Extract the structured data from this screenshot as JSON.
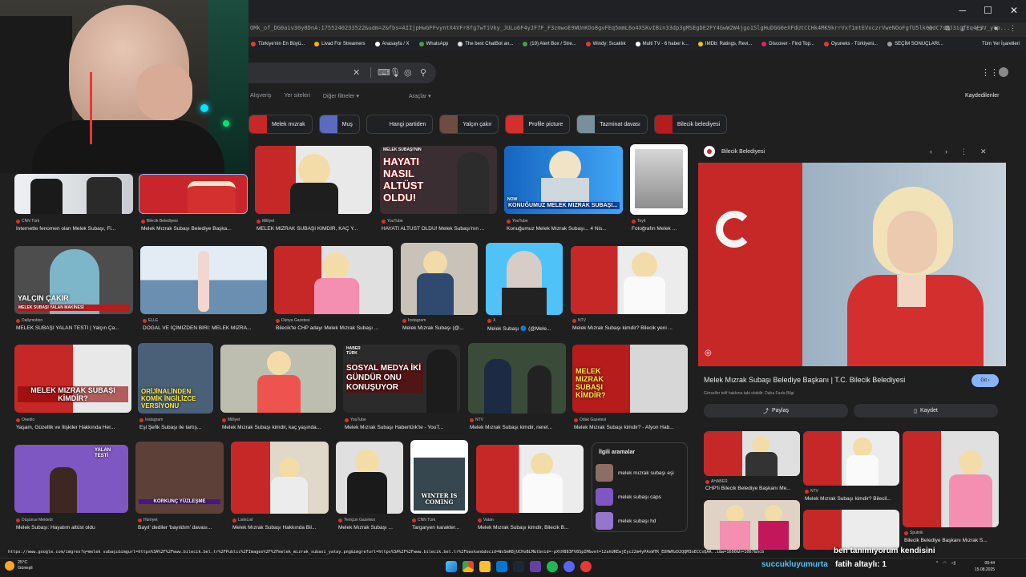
{
  "browser": {
    "address_url": "OMk_of_DG0aiv30y8DnA:1755240233522&udm=2&fbs=AIIjpHwGFFvyntX4VFr8fg7wTiVky_JULu6F4yJF7F_F3zmwoE9WUnKOo8gvFEq5mmL6o4XSKvIBin33dp3gMSEgDE2FY4GwW2W4jgo1SlgHuDGG0eXFdUtCCHk4MK9krrVxf1mtEVxczrVweNOoFgfU5lk00dC7sXJ3igfEq4F3V_yYp...",
    "bookmarks": [
      {
        "label": "Türkiye'nin En Büyü...",
        "color": "#e53935"
      },
      {
        "label": "Livad For Streamers",
        "color": "#ffb300"
      },
      {
        "label": "Anasayfa / X",
        "color": "#ffffff"
      },
      {
        "label": "WhatsApp",
        "color": "#43a047"
      },
      {
        "label": "The best ChatBot an...",
        "color": "#e0e0e0"
      },
      {
        "label": "(19) Alert Box / Stre...",
        "color": "#43a047"
      },
      {
        "label": "Windy: Sıcaklık",
        "color": "#e53935"
      },
      {
        "label": "Multi TV - 6 haber k...",
        "color": "#ffffff"
      },
      {
        "label": "IMDb: Ratings, Revi...",
        "color": "#f5c518"
      },
      {
        "label": "Discover - Find Top...",
        "color": "#e91e63"
      },
      {
        "label": "Oyuneks - Türkiyeni...",
        "color": "#e53935"
      },
      {
        "label": "SEÇİM SONUÇLARI...",
        "color": "#9e9e9e"
      }
    ],
    "all_bookmarks": "Tüm Yer İşaretleri"
  },
  "filters": {
    "tabs": [
      "Alışveriş",
      "Yer siteleri",
      "Diğer filtreler ▾"
    ],
    "tools": "Araçlar ▾",
    "saved": "Kaydedilenler"
  },
  "chips": [
    {
      "label": "Melek mızrak",
      "color": "#c62828"
    },
    {
      "label": "Muş",
      "color": "#5c6bc0"
    },
    {
      "label": "Hangi partiden",
      "color": "#202124"
    },
    {
      "label": "Yalçın çakır",
      "color": "#6d4c41"
    },
    {
      "label": "Profile picture",
      "color": "#d32f2f"
    },
    {
      "label": "Tazminat davası",
      "color": "#78909c"
    },
    {
      "label": "Bilecik belediyesi",
      "color": "#b71c1c"
    }
  ],
  "thumbs": {
    "t1": {
      "src": "CNN Türk",
      "cap": "İnternette fenomen olan Melek Subaşı, Fi..."
    },
    "t2": {
      "src": "Bilecik Belediyesi",
      "cap": "Melek Mızrak Subaşı Belediye Başka..."
    },
    "t3": {
      "src": "Milliyet",
      "cap": "MELEK MIZRAK SUBAŞI KİMDİR, KAÇ Y..."
    },
    "t4": {
      "src": "YouTube",
      "cap": "HAYATI ALTÜST OLDU! Melek Subaşı'nın ...",
      "overlay_top": "MELEK SUBAŞI'NIN",
      "overlay": "HAYATI NASIL ALTÜST OLDU!"
    },
    "t5": {
      "src": "YouTube",
      "cap": "Konuğumuz Melek Mızrak Subaşı... 4 Nis...",
      "overlay_top": "NOW",
      "overlay": "KONUĞUMUZ MELEK MIZRAK SUBAŞI..."
    },
    "t6": {
      "src": "Teyit",
      "cap": "Fotoğrafın Melek ..."
    },
    "t7": {
      "src": "Dailymotion",
      "cap": "MELEK SUBAŞI YALAN TESTİ | Yalçın Ça...",
      "overlay": "YALÇIN ÇAKIR",
      "overlay_sub": "MELEK SUBAŞI YALAN MAKİNESİ"
    },
    "t8": {
      "src": "ELLE",
      "cap": "DOĞAL VE İÇİMİZDEN BİRİ: MELEK MIZRA..."
    },
    "t9": {
      "src": "Dünya Gazetesi",
      "cap": "Bilecik'te CHP adayı Melek Mızrak Subaşı ..."
    },
    "t10": {
      "src": "Instagram",
      "cap": "Melek Mızrak Subaşı (@..."
    },
    "t11": {
      "src": "X",
      "cap": "Melek Subaşı 🔵 (@Mele..."
    },
    "t12": {
      "src": "NTV",
      "cap": "Melek Mızrak Subaşı kimdir? Bilecik yeni ..."
    },
    "t13": {
      "src": "Onedio",
      "cap": "Yaşam, Güzellik ve İlişkiler Hakkında Her...",
      "overlay": "MELEK MIZRAK SUBAŞI KİMDİR?"
    },
    "t14": {
      "src": "Instagram",
      "cap": "Eşi Şefik Subaşı ile tartış...",
      "overlay": "ORİJİNALİNDEN KOMİK İNGİLİZCE VERSİYONU"
    },
    "t15": {
      "src": "Milliyet",
      "cap": "Melek Mızrak Subaşı kimdir, kaç yaşında..."
    },
    "t16": {
      "src": "YouTube",
      "cap": "Melek Mızrak Subaşı Habertürk'te - YouT...",
      "overlay": "SOSYAL MEDYA İKİ GÜNDÜR ONU KONUŞUYOR",
      "overlay_top": "HABER TÜRK"
    },
    "t17": {
      "src": "NTV",
      "cap": "Melek Mızrak Subaşı kimdir, nerel..."
    },
    "t18": {
      "src": "Odak Gazetesi",
      "cap": "Melek Mızrak Subaşı kimdir? - Afyon Hab...",
      "overlay": "MELEK MIZRAK SUBAŞI KİMDİR?"
    },
    "t19": {
      "src": "Düşünce Mektebi",
      "cap": "Melek Subaşı: Hayatım altüst oldu",
      "overlay": "YALAN TESTİ"
    },
    "t20": {
      "src": "Hürriyet",
      "cap": "Bayıl' dediler 'bayıldım' davası...",
      "overlay": "KORKUNÇ YÜZLEŞME"
    },
    "t21": {
      "src": "ListeList",
      "cap": "Melek Mızrak Subaşı Hakkında Bil..."
    },
    "t22": {
      "src": "Yeniçün Gazetesi",
      "cap": "Melek Mızrak Subaşı ..."
    },
    "t23": {
      "src": "CNN Türk",
      "cap": "Targaryen karakter...",
      "overlay": "WINTER IS COMING"
    },
    "t24": {
      "src": "Vatan",
      "cap": "Melek Mızrak Subaşı kimdir, Bilecik B..."
    }
  },
  "related": {
    "title": "İlgili aramalar",
    "items": [
      "melek mızrak subaşı eşi",
      "melek subaşı caps",
      "melek subaşı hd"
    ]
  },
  "panel": {
    "source": "Bilecik Belediyesi",
    "title": "Melek Mızrak Subaşı Belediye Başkanı | T.C. Bilecik Belediyesi",
    "go_label": "Git ›",
    "note": "Görseller telif hakkına tabi olabilir. Daha Fazla Bilgi",
    "share_label": "Paylaş",
    "save_label": "Kaydet",
    "r1": {
      "src": "AHABER",
      "cap": "CHP'li Bilecik Belediye Başkanı Me..."
    },
    "r2": {
      "src": "NTV",
      "cap": "Melek Mızrak Subaşı kimdir? Bilecil..."
    },
    "r3": {
      "src": "Sputnik",
      "cap": "Bilecik Belediye Başkanı Mızrak S..."
    }
  },
  "status_url": "https://www.google.com/imgres?q=melek subaşı&imgurl=https%3A%2F%2Fwww.bilecik.bel.tr%2FPublic%2FImages%2F%2Fmelek_mizrak_subasi_yatay.png&imgrefurl=https%3A%2F%2Fwww.bilecik.bel.tr%2Fbaskan&docid=WsSmR8jUCHoBLM&tbnid=-pXtH883FV8SpIM&vet=12ahUKEwjEyc22m4yPAxWTR_EDHWHzD2QQM3oECCsQAA..i&w=1600&h=1067&hcb",
  "overlay_texts": {
    "subtitle": "ben tanımıyorum kendisini",
    "chat_user": "succukluyumurta",
    "chat_msg": "fatih altaylı: 1"
  },
  "taskbar": {
    "temp": "25°C",
    "weather": "Güneşli",
    "time": "09:44",
    "date": "15.08.2025"
  }
}
